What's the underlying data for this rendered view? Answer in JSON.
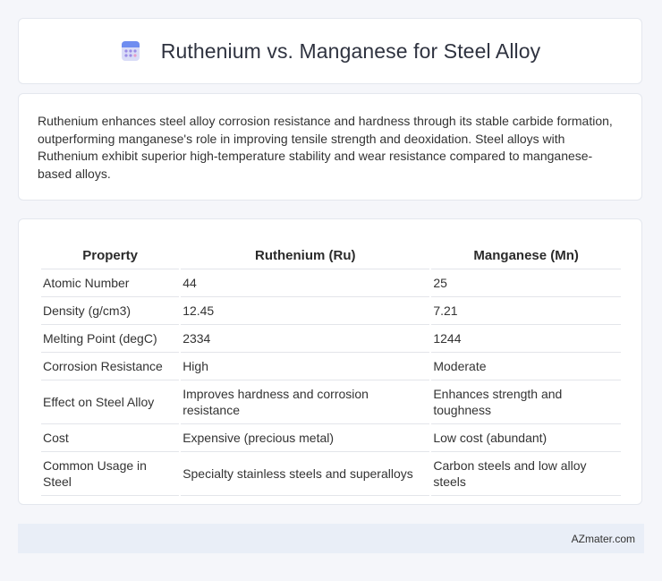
{
  "header": {
    "title": "Ruthenium vs. Manganese for Steel Alloy",
    "icon": "calculator-icon"
  },
  "intro": {
    "text": "Ruthenium enhances steel alloy corrosion resistance and hardness through its stable carbide formation, outperforming manganese's role in improving tensile strength and deoxidation. Steel alloys with Ruthenium exhibit superior high-temperature stability and wear resistance compared to manganese-based alloys."
  },
  "table": {
    "headers": [
      "Property",
      "Ruthenium (Ru)",
      "Manganese (Mn)"
    ],
    "rows": [
      [
        "Atomic Number",
        "44",
        "25"
      ],
      [
        "Density (g/cm3)",
        "12.45",
        "7.21"
      ],
      [
        "Melting Point (degC)",
        "2334",
        "1244"
      ],
      [
        "Corrosion Resistance",
        "High",
        "Moderate"
      ],
      [
        "Effect on Steel Alloy",
        "Improves hardness and corrosion resistance",
        "Enhances strength and toughness"
      ],
      [
        "Cost",
        "Expensive (precious metal)",
        "Low cost (abundant)"
      ],
      [
        "Common Usage in Steel",
        "Specialty stainless steels and superalloys",
        "Carbon steels and low alloy steels"
      ]
    ]
  },
  "footer": {
    "brand": "AZmater.com"
  }
}
